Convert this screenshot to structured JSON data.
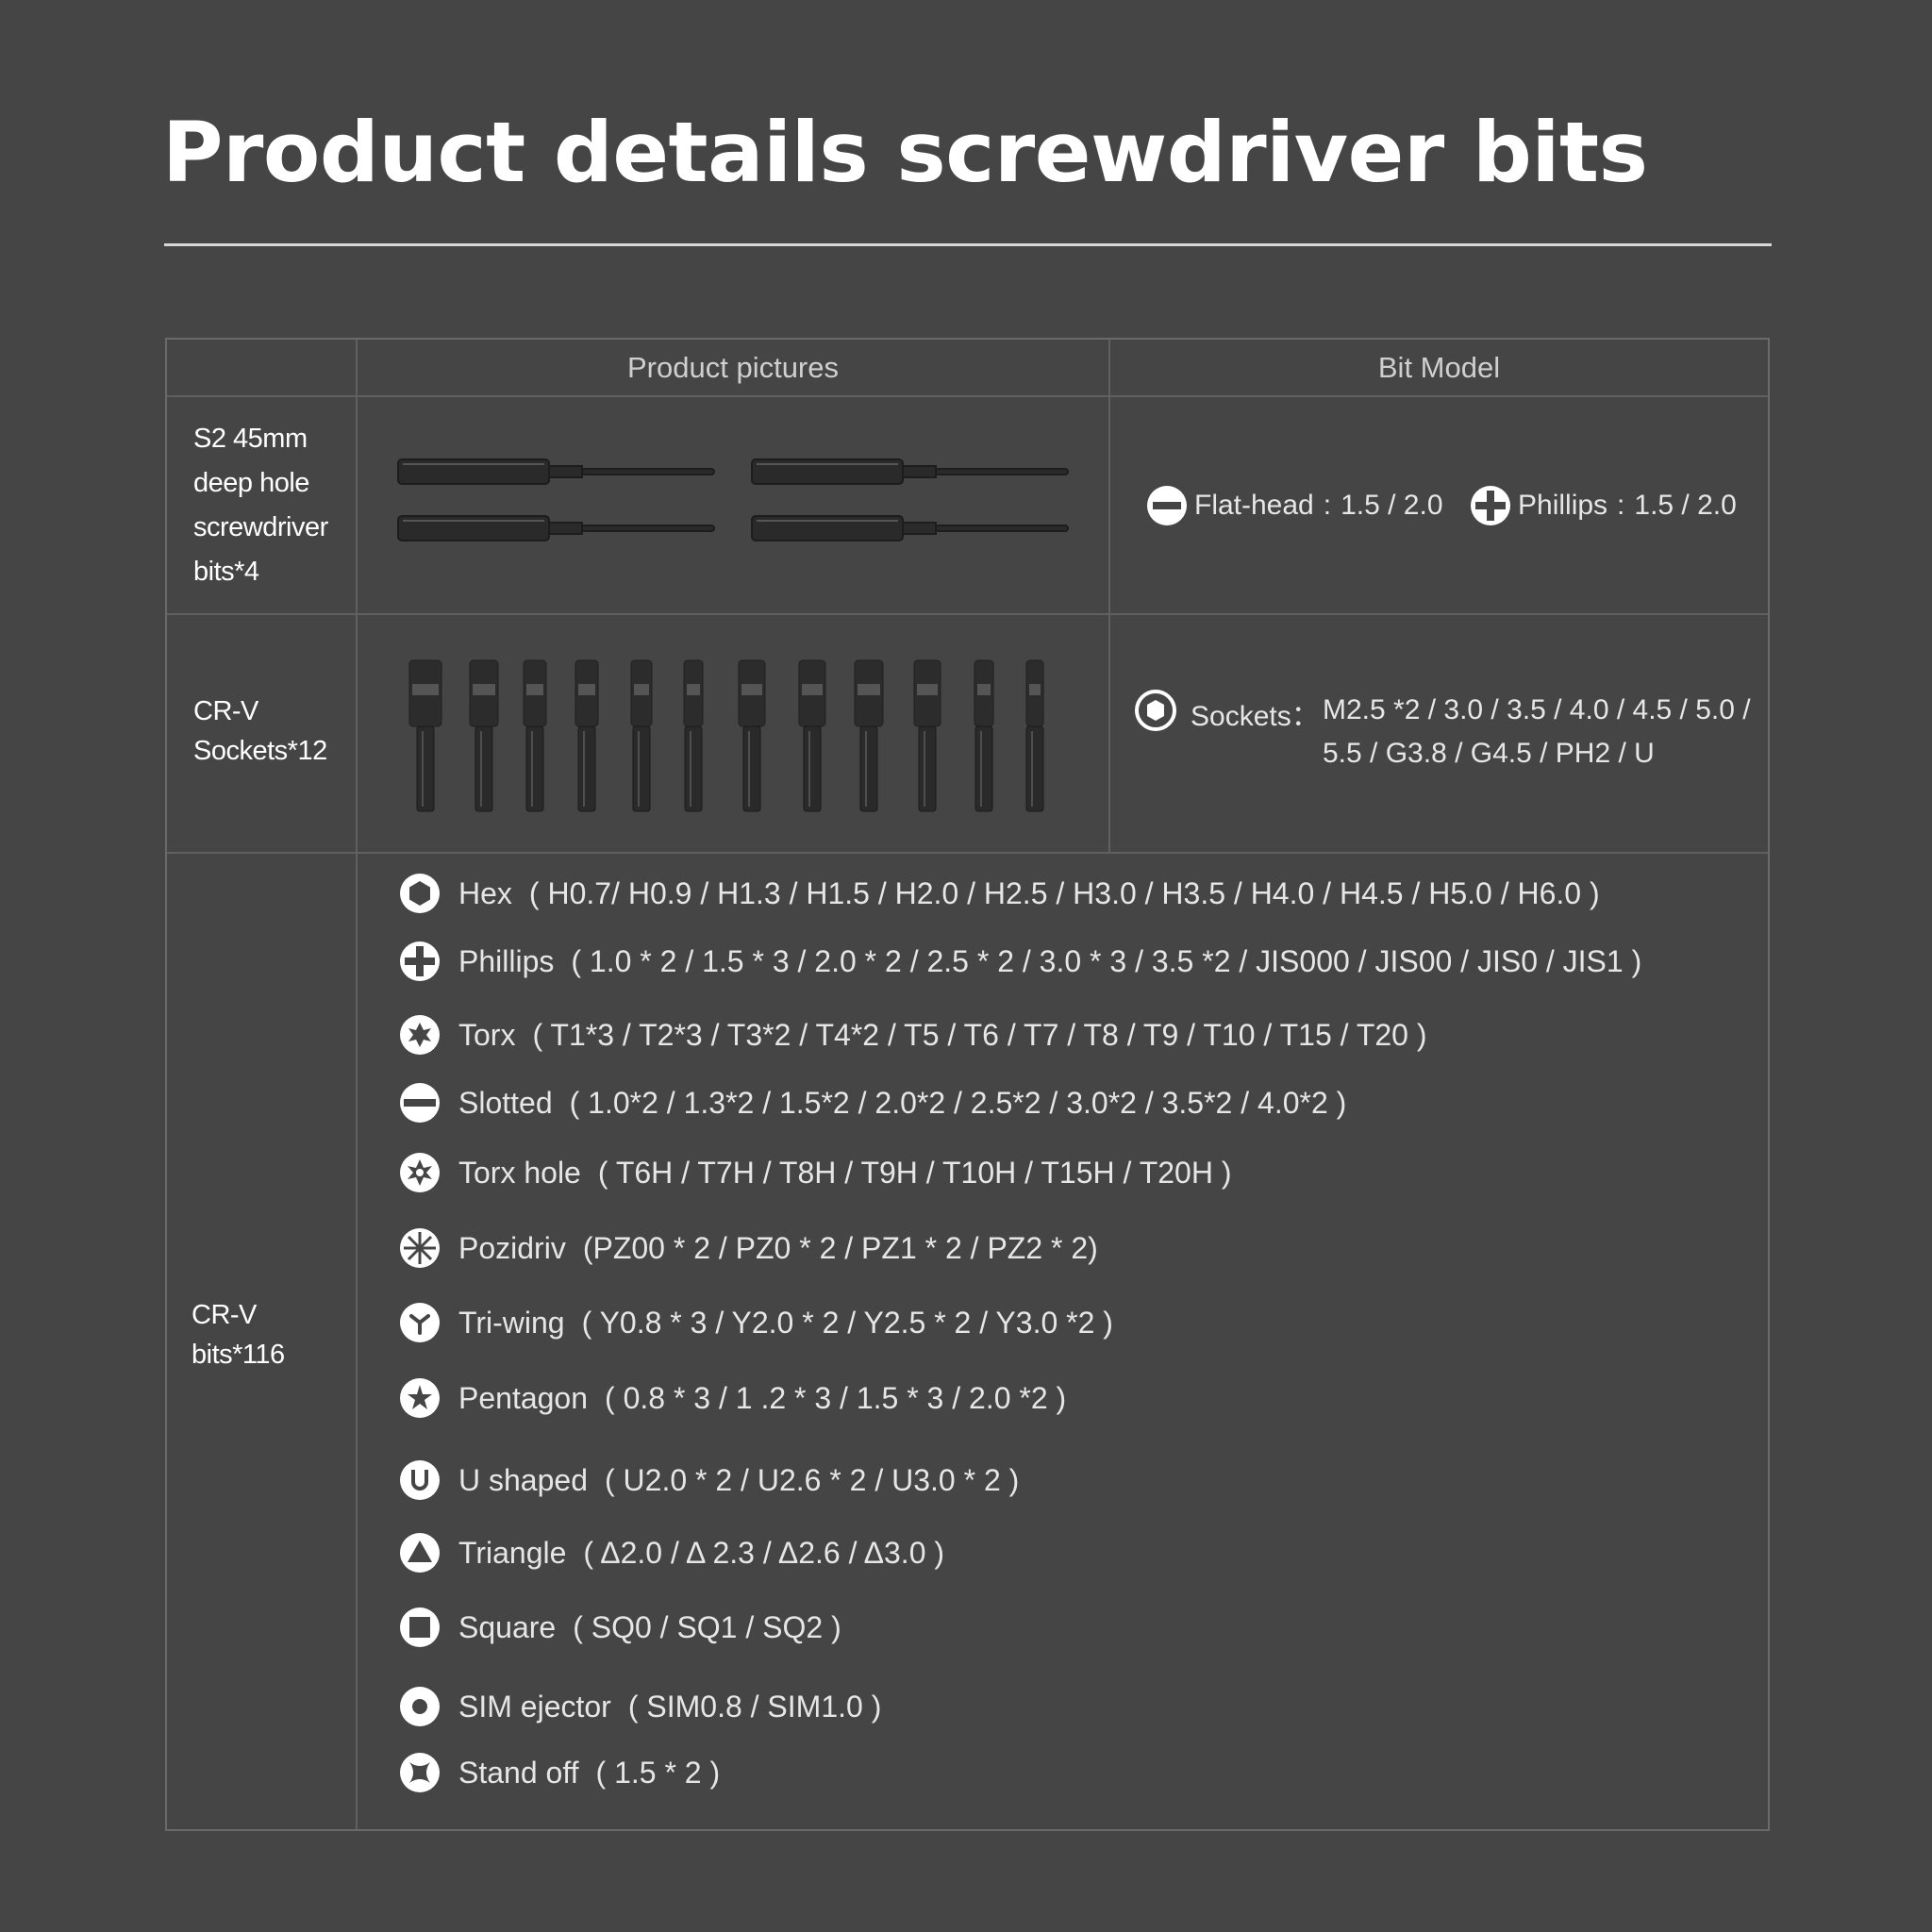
{
  "title": "Product details screwdriver bits",
  "headers": {
    "pictures": "Product pictures",
    "model": "Bit Model"
  },
  "rows": [
    {
      "label": "S2 45mm deep hole screwdriver bits*4",
      "specs": [
        {
          "icon": "flat-head-icon",
          "name": "Flat-head",
          "value": "1.5 / 2.0"
        },
        {
          "icon": "phillips-icon",
          "name": "Phillips",
          "value": "1.5 / 2.0"
        }
      ]
    },
    {
      "label": "CR-V Sockets*12",
      "spec": {
        "icon": "socket-hex-icon",
        "name": "Sockets：",
        "line1": "M2.5 *2 / 3.0 / 3.5 / 4.0 / 4.5 / 5.0 /",
        "line2": "5.5 / G3.8 / G4.5 / PH2 / U"
      }
    },
    {
      "label": "CR-V bits*116",
      "items": [
        {
          "icon": "hex-icon",
          "name": "Hex",
          "value": "( H0.7/ H0.9 / H1.3 / H1.5 / H2.0 / H2.5 / H3.0 / H3.5 / H4.0 / H4.5 / H5.0 / H6.0 )"
        },
        {
          "icon": "phillips-icon",
          "name": "Phillips",
          "value": "( 1.0 * 2 / 1.5 * 3 / 2.0 * 2 / 2.5 * 2 / 3.0 * 3 / 3.5 *2 / JIS000  / JIS00 / JIS0 / JIS1 )"
        },
        {
          "icon": "torx-icon",
          "name": "Torx",
          "value": "( T1*3 / T2*3 / T3*2 / T4*2 / T5 / T6 / T7 / T8 / T9 / T10 / T15 / T20 )"
        },
        {
          "icon": "slotted-icon",
          "name": "Slotted",
          "value": "( 1.0*2 / 1.3*2 / 1.5*2 / 2.0*2 / 2.5*2 / 3.0*2 / 3.5*2  / 4.0*2 )"
        },
        {
          "icon": "torx-hole-icon",
          "name": "Torx hole",
          "value": "( T6H / T7H / T8H / T9H / T10H / T15H / T20H  )"
        },
        {
          "icon": "pozidriv-icon",
          "name": "Pozidriv",
          "value": "(PZ00 * 2 / PZ0 * 2 / PZ1 * 2 / PZ2 * 2)"
        },
        {
          "icon": "tri-wing-icon",
          "name": "Tri-wing",
          "value": "( Y0.8 * 3 / Y2.0 * 2 / Y2.5 * 2 / Y3.0 *2  )"
        },
        {
          "icon": "pentagon-icon",
          "name": "Pentagon",
          "value": "( 0.8 * 3 / 1 .2 * 3 / 1.5 * 3 / 2.0 *2  )"
        },
        {
          "icon": "u-shaped-icon",
          "name": "U shaped",
          "value": "( U2.0 * 2 / U2.6 * 2 / U3.0 * 2  )"
        },
        {
          "icon": "triangle-icon",
          "name": "Triangle",
          "value": "( Δ2.0 / Δ 2.3 / Δ2.6 / Δ3.0 )"
        },
        {
          "icon": "square-icon",
          "name": "Square",
          "value": "( SQ0 / SQ1 / SQ2 )"
        },
        {
          "icon": "sim-ejector-icon",
          "name": "SIM ejector",
          "value": "( SIM0.8  / SIM1.0 )"
        },
        {
          "icon": "stand-off-icon",
          "name": "Stand off",
          "value": "( 1.5 * 2  )"
        }
      ]
    }
  ]
}
